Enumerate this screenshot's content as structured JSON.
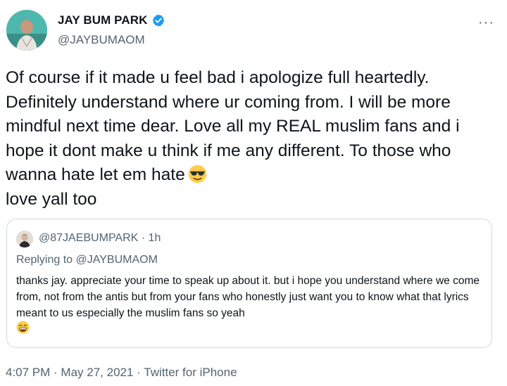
{
  "author": {
    "display_name": "JAY BUM PARK",
    "handle": "@JAYBUMAOM",
    "verified": true
  },
  "tweet": {
    "text": "Of course if it made u feel bad i apologize full heartedly.  Definitely understand where ur coming from. I will be more mindful next time dear. Love all my REAL muslim fans and i hope it dont make u think if me any different. To those who wanna hate let em hate",
    "text_tail": "love yall too",
    "emoji": "sunglasses-emoji"
  },
  "quote": {
    "handle": "@87JAEBUMPARK",
    "separator": " · ",
    "age": "1h",
    "replying_prefix": "Replying to ",
    "replying_to": "@JAYBUMAOM",
    "text": "thanks jay. appreciate your time to speak up about it. but i hope you understand where we come from, not from the antis but from your fans who honestly just want you to know what that lyrics meant to us especially the muslim fans so yeah",
    "emoji": "grinning-emoji"
  },
  "meta": {
    "time": "4:07 PM",
    "sep1": " · ",
    "date": "May 27, 2021",
    "sep2": " · ",
    "source": "Twitter for iPhone"
  },
  "more_label": "···",
  "colors": {
    "text": "#0f1419",
    "secondary": "#536471",
    "verified": "#1d9bf0",
    "border": "#cfd9de"
  }
}
